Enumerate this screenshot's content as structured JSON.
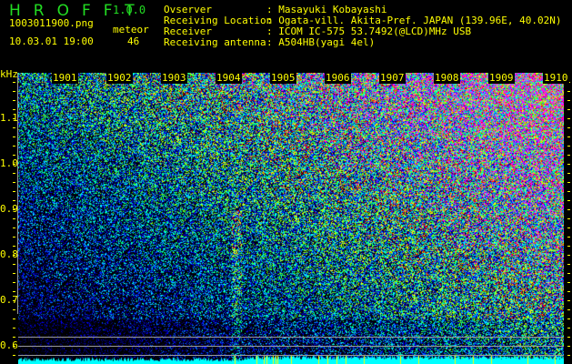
{
  "app": {
    "title": "HROFFT",
    "version": "1.0.0"
  },
  "file": {
    "name": "1003011900.png",
    "datetime": "10.03.01 19:00"
  },
  "meteor": {
    "label": "meteor",
    "count": "46"
  },
  "info": [
    {
      "key": "Ovserver",
      "value": "Masayuki Kobayashi"
    },
    {
      "key": "Receiving Location",
      "value": "Ogata-vill. Akita-Pref. JAPAN (139.96E, 40.02N)"
    },
    {
      "key": "Receiver",
      "value": "ICOM IC-575 53.7492(@LCD)MHz USB"
    },
    {
      "key": "Receiving antenna",
      "value": "A504HB(yagi 4el)"
    }
  ],
  "axis": {
    "y_unit": "kHz",
    "y_ticks": [
      "1.1",
      "1.0",
      "0.9",
      "0.8",
      "0.7",
      "0.6"
    ],
    "time_ticks": [
      "1901",
      "1902",
      "1903",
      "1904",
      "1905",
      "1906",
      "1907",
      "1908",
      "1909",
      "1910"
    ]
  },
  "colors": {
    "text": "#ffff00",
    "title": "#22dd22",
    "baseline": "#00ffff"
  }
}
